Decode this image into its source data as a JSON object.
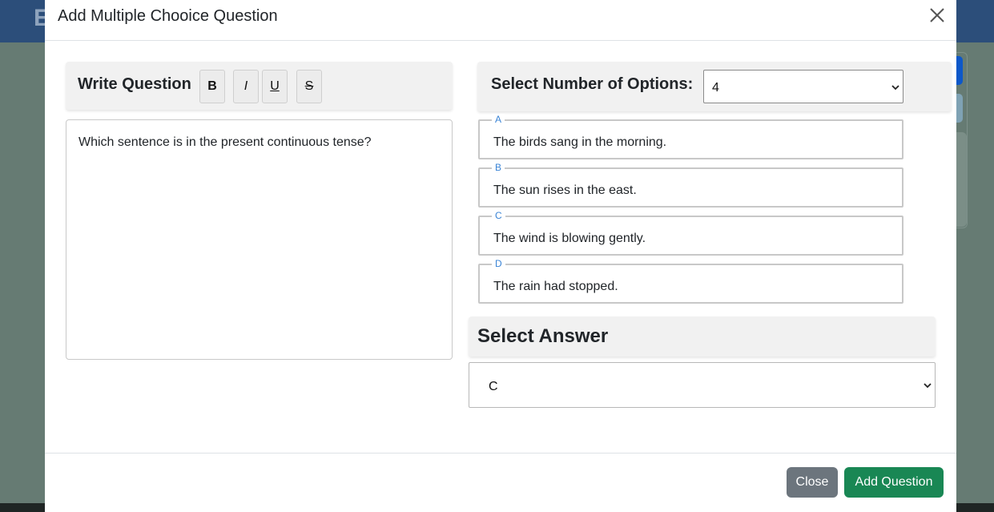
{
  "background": {
    "app_letter": "E"
  },
  "modal": {
    "title": "Add Multiple Chooice Question"
  },
  "question_panel": {
    "heading": "Write Question",
    "format_buttons": {
      "bold": "B",
      "italic": "I",
      "underline": "U",
      "strike": "S"
    },
    "question_text": "Which sentence is in the present continuous tense?"
  },
  "options_panel": {
    "heading": "Select Number of Options:",
    "selected_count": "4",
    "options": [
      {
        "letter": "A",
        "text": "The birds sang in the morning."
      },
      {
        "letter": "B",
        "text": "The sun rises in the east."
      },
      {
        "letter": "C",
        "text": "The wind is blowing gently."
      },
      {
        "letter": "D",
        "text": "The rain had stopped."
      }
    ]
  },
  "answer_panel": {
    "heading": "Select Answer",
    "selected_answer": "C"
  },
  "footer": {
    "close_label": "Close",
    "add_label": "Add Question"
  },
  "colors": {
    "primary_blue": "#2c4e7a",
    "success": "#198754",
    "secondary": "#6c757d",
    "legend_blue": "#3a84d6"
  }
}
